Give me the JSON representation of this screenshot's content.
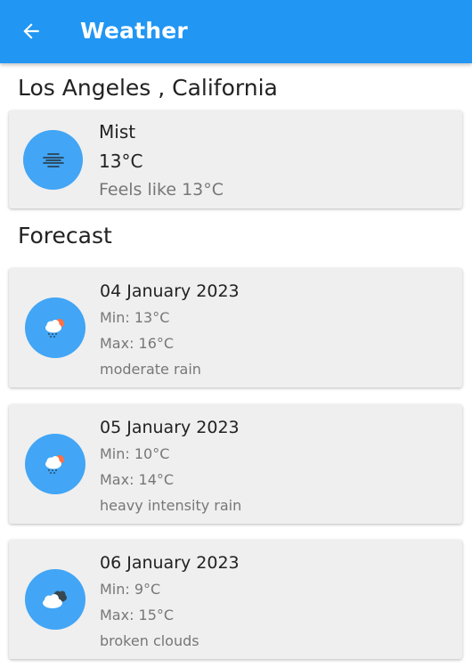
{
  "appbar": {
    "title": "Weather",
    "back_icon": "arrow-left-icon"
  },
  "location": "Los Angeles , California",
  "current": {
    "condition": "Mist",
    "temperature": "13°C",
    "feels_like": "Feels like 13°C",
    "icon": "mist-icon"
  },
  "forecast_title": "Forecast",
  "forecast": [
    {
      "date": "04 January 2023",
      "min": "Min: 13°C",
      "max": "Max: 16°C",
      "description": "moderate rain",
      "icon": "rain-sun-cloud-icon"
    },
    {
      "date": "05 January 2023",
      "min": "Min: 10°C",
      "max": "Max: 14°C",
      "description": "heavy intensity rain",
      "icon": "rain-sun-cloud-icon"
    },
    {
      "date": "06 January 2023",
      "min": "Min: 9°C",
      "max": "Max: 15°C",
      "description": "broken clouds",
      "icon": "broken-clouds-icon"
    }
  ],
  "colors": {
    "appbar": "#2196f3",
    "icon_circle": "#42a5f5",
    "card": "#efefef"
  }
}
